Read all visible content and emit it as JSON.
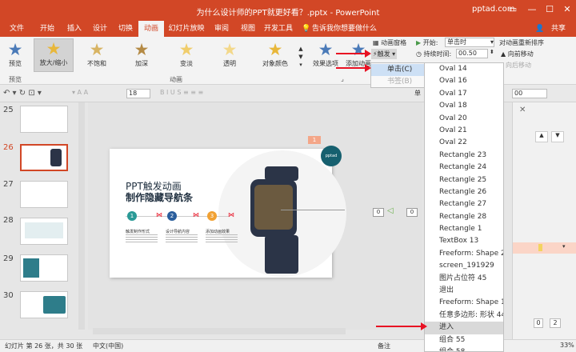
{
  "window": {
    "title": "为什么设计师的PPT就更好看？.pptx - PowerPoint",
    "site": "pptad.com",
    "share": "共享"
  },
  "tabs": [
    "文件",
    "开始",
    "插入",
    "设计",
    "切换",
    "动画",
    "幻灯片放映",
    "审阅",
    "视图",
    "开发工具"
  ],
  "tell_me": "告诉我你想要做什么",
  "ribbon": {
    "preview": "预览",
    "preview_group": "预览",
    "effects": [
      "放大/缩小",
      "不饱和",
      "加深",
      "变淡",
      "透明",
      "对象颜色"
    ],
    "effect_options": "效果选项",
    "add_animation": "添加动画",
    "anim_group": "动画",
    "anim_pane": "动画窗格",
    "trigger": "触发",
    "start_label": "开始:",
    "start_value": "单击时",
    "duration_label": "持续时间:",
    "duration_value": "00.50",
    "reorder": "对动画重新排序",
    "move_earlier": "向前移动",
    "move_later": "向后移动",
    "delay_suffix": "00",
    "font_size": "18",
    "col_w": "单"
  },
  "submenu": {
    "on_click": "单击(C)",
    "on_bookmark": "书签(B)"
  },
  "dropdown": [
    "Oval 14",
    "Oval 16",
    "Oval 17",
    "Oval 18",
    "Oval 20",
    "Oval 21",
    "Oval 22",
    "Rectangle 23",
    "Rectangle 24",
    "Rectangle 25",
    "Rectangle 26",
    "Rectangle 27",
    "Rectangle 28",
    "Rectangle 1",
    "TextBox 13",
    "Freeform: Shape 21",
    "screen_191929",
    "图片占位符 45",
    "退出",
    "Freeform: Shape 10",
    "任意多边形: 形状 44",
    "进入",
    "组合 55",
    "组合 58"
  ],
  "thumbs": [
    "25",
    "26",
    "27",
    "28",
    "29",
    "30"
  ],
  "slide": {
    "logo": "pptad",
    "small_title": "",
    "title1": "PPT触发动画",
    "title2": "制作隐藏导航条",
    "items": [
      {
        "n": "1",
        "t": "触发制作形式"
      },
      {
        "n": "2",
        "t": "设计导航内容"
      },
      {
        "n": "3",
        "t": "添加动画效果"
      }
    ],
    "badge_num": "1",
    "pane_0a": "0",
    "pane_0b": "0"
  },
  "status": {
    "slide_info": "幻灯片 第 26 张，共 30 张",
    "lang": "中文(中国)",
    "notes": "备注",
    "zoom": "33%"
  },
  "right_pane": {
    "num1": "0",
    "num2": "2"
  },
  "colors": {
    "accent": "#d24726",
    "highlight": "#d9d9d9",
    "arrow": "#e81123"
  }
}
